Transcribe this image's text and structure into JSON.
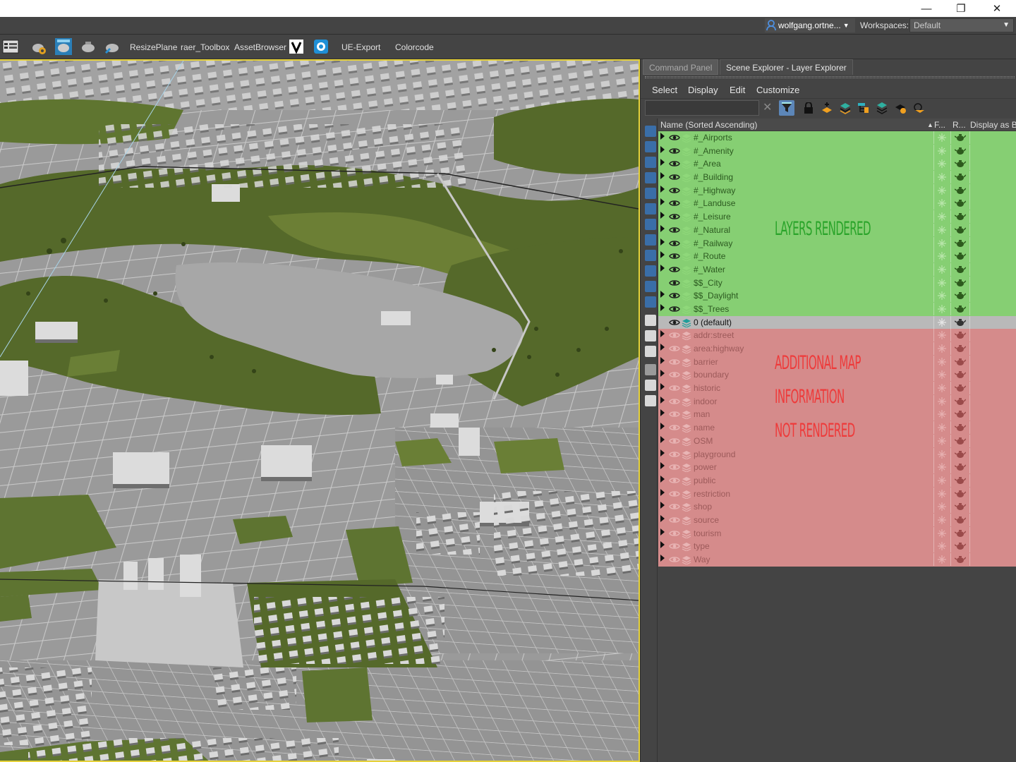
{
  "window": {
    "minimize_icon": "minimize-icon",
    "restore_icon": "restore-icon",
    "close_icon": "close-icon"
  },
  "userbar": {
    "user_name": "wolfgang.ortne...",
    "workspaces_label": "Workspaces:",
    "workspace_value": "Default"
  },
  "toolbar": {
    "items": [
      "ResizePlane",
      "raer_Toolbox",
      "AssetBrowser",
      "UE-Export",
      "Colorcode"
    ]
  },
  "panel": {
    "tabs": [
      "Command Panel",
      "Scene Explorer - Layer Explorer"
    ],
    "menus": [
      "Select",
      "Display",
      "Edit",
      "Customize"
    ],
    "search_value": "",
    "columns": {
      "name": "Name (Sorted Ascending)",
      "f": "F...",
      "r": "R...",
      "display": "Display as Bo"
    }
  },
  "layers_rendered": [
    {
      "name": "#_Airports",
      "expandable": true
    },
    {
      "name": "#_Amenity",
      "expandable": true
    },
    {
      "name": "#_Area",
      "expandable": true
    },
    {
      "name": "#_Building",
      "expandable": true
    },
    {
      "name": "#_Highway",
      "expandable": true
    },
    {
      "name": "#_Landuse",
      "expandable": true
    },
    {
      "name": "#_Leisure",
      "expandable": true
    },
    {
      "name": "#_Natural",
      "expandable": true
    },
    {
      "name": "#_Railway",
      "expandable": true
    },
    {
      "name": "#_Route",
      "expandable": true
    },
    {
      "name": "#_Water",
      "expandable": true
    },
    {
      "name": "$$_City",
      "expandable": false
    },
    {
      "name": "$$_Daylight",
      "expandable": true
    },
    {
      "name": "$$_Trees",
      "expandable": true
    }
  ],
  "default_layer": {
    "name": "0 (default)"
  },
  "layers_not_rendered": [
    "addr:street",
    "area:highway",
    "barrier",
    "boundary",
    "historic",
    "indoor",
    "man",
    "name",
    "OSM",
    "playground",
    "power",
    "public",
    "restriction",
    "shop",
    "source",
    "tourism",
    "type",
    "Way"
  ],
  "annotations": {
    "rendered": "LAYERS RENDERED",
    "not_rendered_1": "ADDITIONAL MAP",
    "not_rendered_2": "INFORMATION",
    "not_rendered_3": "NOT RENDERED"
  },
  "colors": {
    "rendered_row": "#86cf73",
    "not_rendered_row": "#d58b8b",
    "default_row": "#b9b9b9",
    "annotation_green": "#2aa42a",
    "annotation_red": "#ee3a3a",
    "viewport_border": "#e6d23a"
  }
}
